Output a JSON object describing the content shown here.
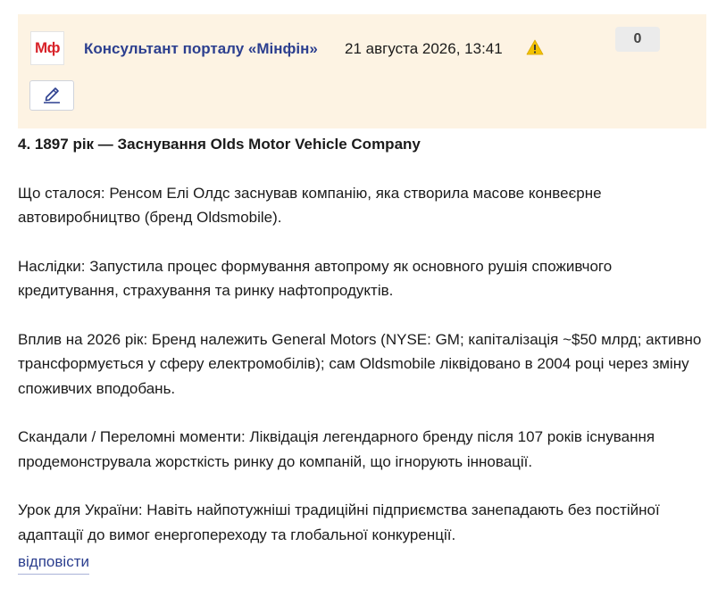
{
  "post": {
    "logo_text": "Мф",
    "author": "Консультант порталу «Мінфін»",
    "datetime": "21 августа 2026, 13:41",
    "vote_count": "0",
    "warn_icon": "warning-triangle-icon",
    "edit_icon": "pencil-icon"
  },
  "content": {
    "heading": "4. 1897 рік — Заснування Olds Motor Vehicle Company",
    "paragraphs": [
      "Що сталося: Ренсом Елі Олдс заснував компанію, яка створила масове конвеєрне автовиробництво (бренд Oldsmobile).",
      "Наслідки: Запустила процес формування автопрому як основного рушія споживчого кредитування, страхування та ринку нафтопродуктів.",
      "Вплив на 2026 рік: Бренд належить General Motors (NYSE: GM; капіталізація ~$50 млрд; активно трансформується у сферу електромобілів); сам Oldsmobile ліквідовано в 2004 році через зміну споживчих вподобань.",
      "Скандали / Переломні моменти: Ліквідація легендарного бренду після 107 років існування продемонструвала жорсткість ринку до компаній, що ігнорують інновації.",
      "Урок для України: Навіть найпотужніші традиційні підприємства занепадають без постійної адаптації до вимог енергопереходу та глобальної конкуренції."
    ]
  },
  "actions": {
    "reply_label": "відповісти"
  },
  "colors": {
    "header_bg": "#fdf3e3",
    "author_link": "#2c3f8f",
    "logo_red": "#d8232a",
    "warning_yellow": "#f2c200"
  }
}
